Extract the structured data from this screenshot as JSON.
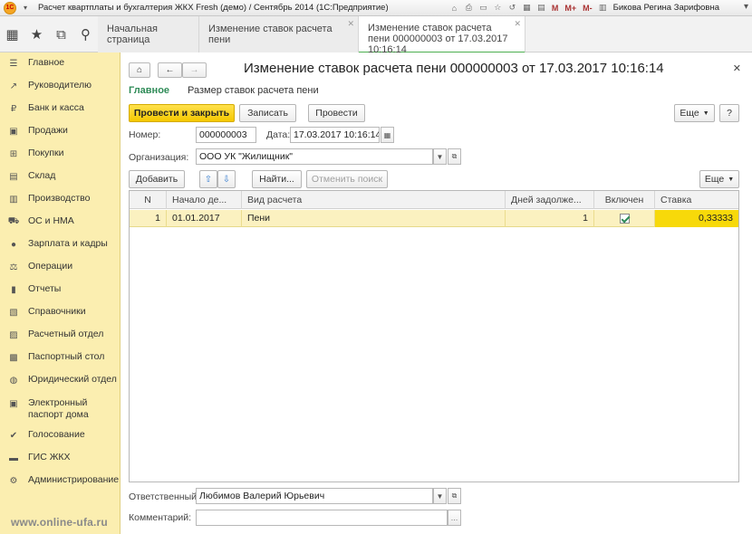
{
  "window": {
    "title": "Расчет квартплаты и бухгалтерия ЖКХ Fresh (демо) / Сентябрь 2014  (1С:Предприятие)",
    "user": "Бикова Регина Зарифовна",
    "icons": [
      "home-icon",
      "print-icon",
      "preview-icon",
      "favorite-icon",
      "history-icon",
      "calendar-icon",
      "calculator-icon",
      "table-icon"
    ],
    "m_labels": [
      "M",
      "M+",
      "M-"
    ],
    "logo_text": "1С"
  },
  "topbar": {
    "icons": [
      "apps-grid-icon",
      "star-icon",
      "history-icon",
      "search-icon"
    ],
    "icon_glyphs": [
      "▦",
      "★",
      "⧉",
      "⚲"
    ],
    "tabs": [
      {
        "label": "Начальная страница"
      },
      {
        "label": "Изменение ставок расчета пени"
      },
      {
        "label": "Изменение ставок расчета пени 000000003 от 17.03.2017 10:16:14"
      }
    ]
  },
  "sidebar": {
    "items": [
      {
        "label": "Главное",
        "icon": "menu-icon",
        "glyph": "☰"
      },
      {
        "label": "Руководителю",
        "icon": "trend-icon",
        "glyph": "↗"
      },
      {
        "label": "Банк и касса",
        "icon": "bank-icon",
        "glyph": "₽"
      },
      {
        "label": "Продажи",
        "icon": "cart-icon",
        "glyph": "▣"
      },
      {
        "label": "Покупки",
        "icon": "basket-icon",
        "glyph": "⊞"
      },
      {
        "label": "Склад",
        "icon": "warehouse-icon",
        "glyph": "▤"
      },
      {
        "label": "Производство",
        "icon": "factory-icon",
        "glyph": "▥"
      },
      {
        "label": "ОС и НМА",
        "icon": "truck-icon",
        "glyph": "⛟"
      },
      {
        "label": "Зарплата и кадры",
        "icon": "person-icon",
        "glyph": "●"
      },
      {
        "label": "Операции",
        "icon": "operations-icon",
        "glyph": "⚖"
      },
      {
        "label": "Отчеты",
        "icon": "chart-icon",
        "glyph": "▮"
      },
      {
        "label": "Справочники",
        "icon": "books-icon",
        "glyph": "▧"
      },
      {
        "label": "Расчетный отдел",
        "icon": "folder-icon",
        "glyph": "▨"
      },
      {
        "label": "Паспортный стол",
        "icon": "passport-icon",
        "glyph": "▩"
      },
      {
        "label": "Юридический отдел",
        "icon": "law-icon",
        "glyph": "◍"
      },
      {
        "label": "Электронный паспорт дома",
        "icon": "house-passport-icon",
        "glyph": "▣"
      },
      {
        "label": "Голосование",
        "icon": "vote-icon",
        "glyph": "✔"
      },
      {
        "label": "ГИС ЖКХ",
        "icon": "gis-icon",
        "glyph": "▬"
      },
      {
        "label": "Администрирование",
        "icon": "settings-icon",
        "glyph": "⚙"
      }
    ],
    "watermark": "www.online-ufa.ru"
  },
  "form": {
    "title": "Изменение ставок расчета пени 000000003 от 17.03.2017 10:16:14",
    "sub_nav": {
      "main": "Главное",
      "rates": "Размер ставок расчета пени"
    },
    "buttons": {
      "post_close": "Провести и закрыть",
      "save": "Записать",
      "post": "Провести",
      "more": "Еще",
      "help": "?"
    },
    "number_label": "Номер:",
    "number_value": "000000003",
    "date_label": "Дата:",
    "date_value": "17.03.2017 10:16:14",
    "org_label": "Организация:",
    "org_value": "ООО УК \"Жилищник\"",
    "table_buttons": {
      "add": "Добавить",
      "find": "Найти...",
      "cancel_search": "Отменить поиск",
      "more": "Еще"
    },
    "table": {
      "columns": [
        "N",
        "Начало де...",
        "Вид расчета",
        "Дней задолже...",
        "Включен",
        "Ставка"
      ],
      "rows": [
        {
          "n": "1",
          "start": "01.01.2017",
          "type": "Пени",
          "days": "1",
          "enabled": true,
          "rate": "0,33333"
        }
      ]
    },
    "responsible_label": "Ответственный:",
    "responsible_value": "Любимов Валерий Юрьевич",
    "comment_label": "Комментарий:",
    "comment_value": ""
  }
}
